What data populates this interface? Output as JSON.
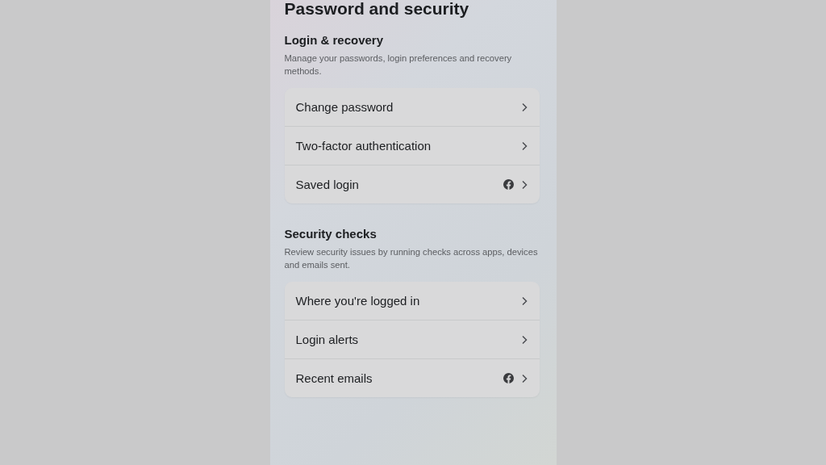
{
  "title": "Password and security",
  "sections": [
    {
      "heading": "Login & recovery",
      "description": "Manage your passwords, login preferences and recovery methods.",
      "items": [
        {
          "label": "Change password",
          "kind": "plain"
        },
        {
          "label": "Two-factor authentication",
          "kind": "plain"
        },
        {
          "label": "Saved login",
          "kind": "account-linked"
        }
      ]
    },
    {
      "heading": "Security checks",
      "description": "Review security issues by running checks across apps, devices and emails sent.",
      "items": [
        {
          "label": "Where you're logged in",
          "kind": "plain"
        },
        {
          "label": "Login alerts",
          "kind": "plain"
        },
        {
          "label": "Recent emails",
          "kind": "account-linked"
        }
      ]
    }
  ]
}
